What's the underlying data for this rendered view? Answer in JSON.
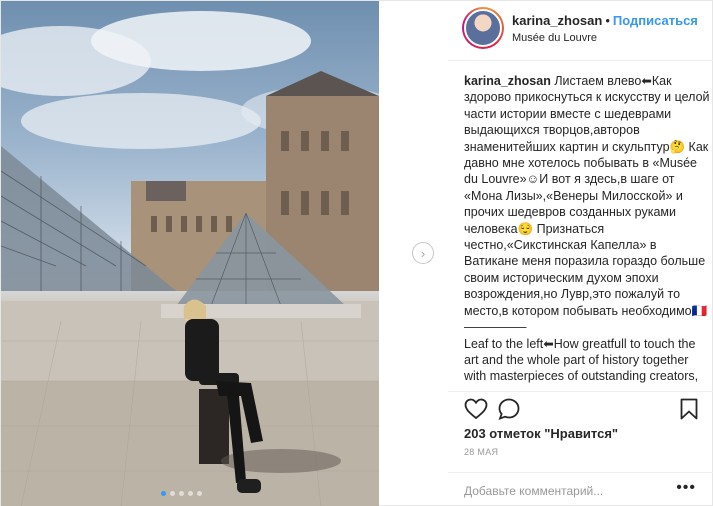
{
  "header": {
    "username": "karina_zhosan",
    "separator": "•",
    "follow_label": "Подписаться",
    "location": "Musée du Louvre"
  },
  "caption": {
    "username": "karina_zhosan",
    "text": " Листаем влево⬅Как здорово прикоснуться к искусству и целой части истории вместе с шедеврами выдающихся творцов,авторов знаменитейших картин и скульптур🤔 Как давно мне хотелось побывать в «Musée du Louvre»☺И вот я здесь,в шаге от «Мона Лизы»,«Венеры Милосской» и прочих шедевров созданных руками человека😌 Признаться честно,«Сикстинская Капелла» в Ватикане меня поразила гораздо больше своим историческим духом эпохи возрождения,но Лувр,это пожалуй то место,в котором побывать необходимо🇫🇷\n—————\nLeaf to the left⬅How greatfull to touch the art and the whole part of history together with masterpieces of outstanding creators,"
  },
  "actions": {
    "likes": "203 отметок \"Нравится\"",
    "date": "28 МАЯ"
  },
  "comment": {
    "placeholder": "Добавьте комментарий...",
    "more": "•••"
  },
  "icons": {
    "like": "heart-icon",
    "comment": "comment-icon",
    "save": "bookmark-icon",
    "next": "chevron-right-icon"
  },
  "colors": {
    "accent": "#3897f0",
    "text": "#262626",
    "muted": "#999999",
    "border": "#efefef"
  },
  "carousel": {
    "slide_count": 5,
    "active_index": 0
  }
}
